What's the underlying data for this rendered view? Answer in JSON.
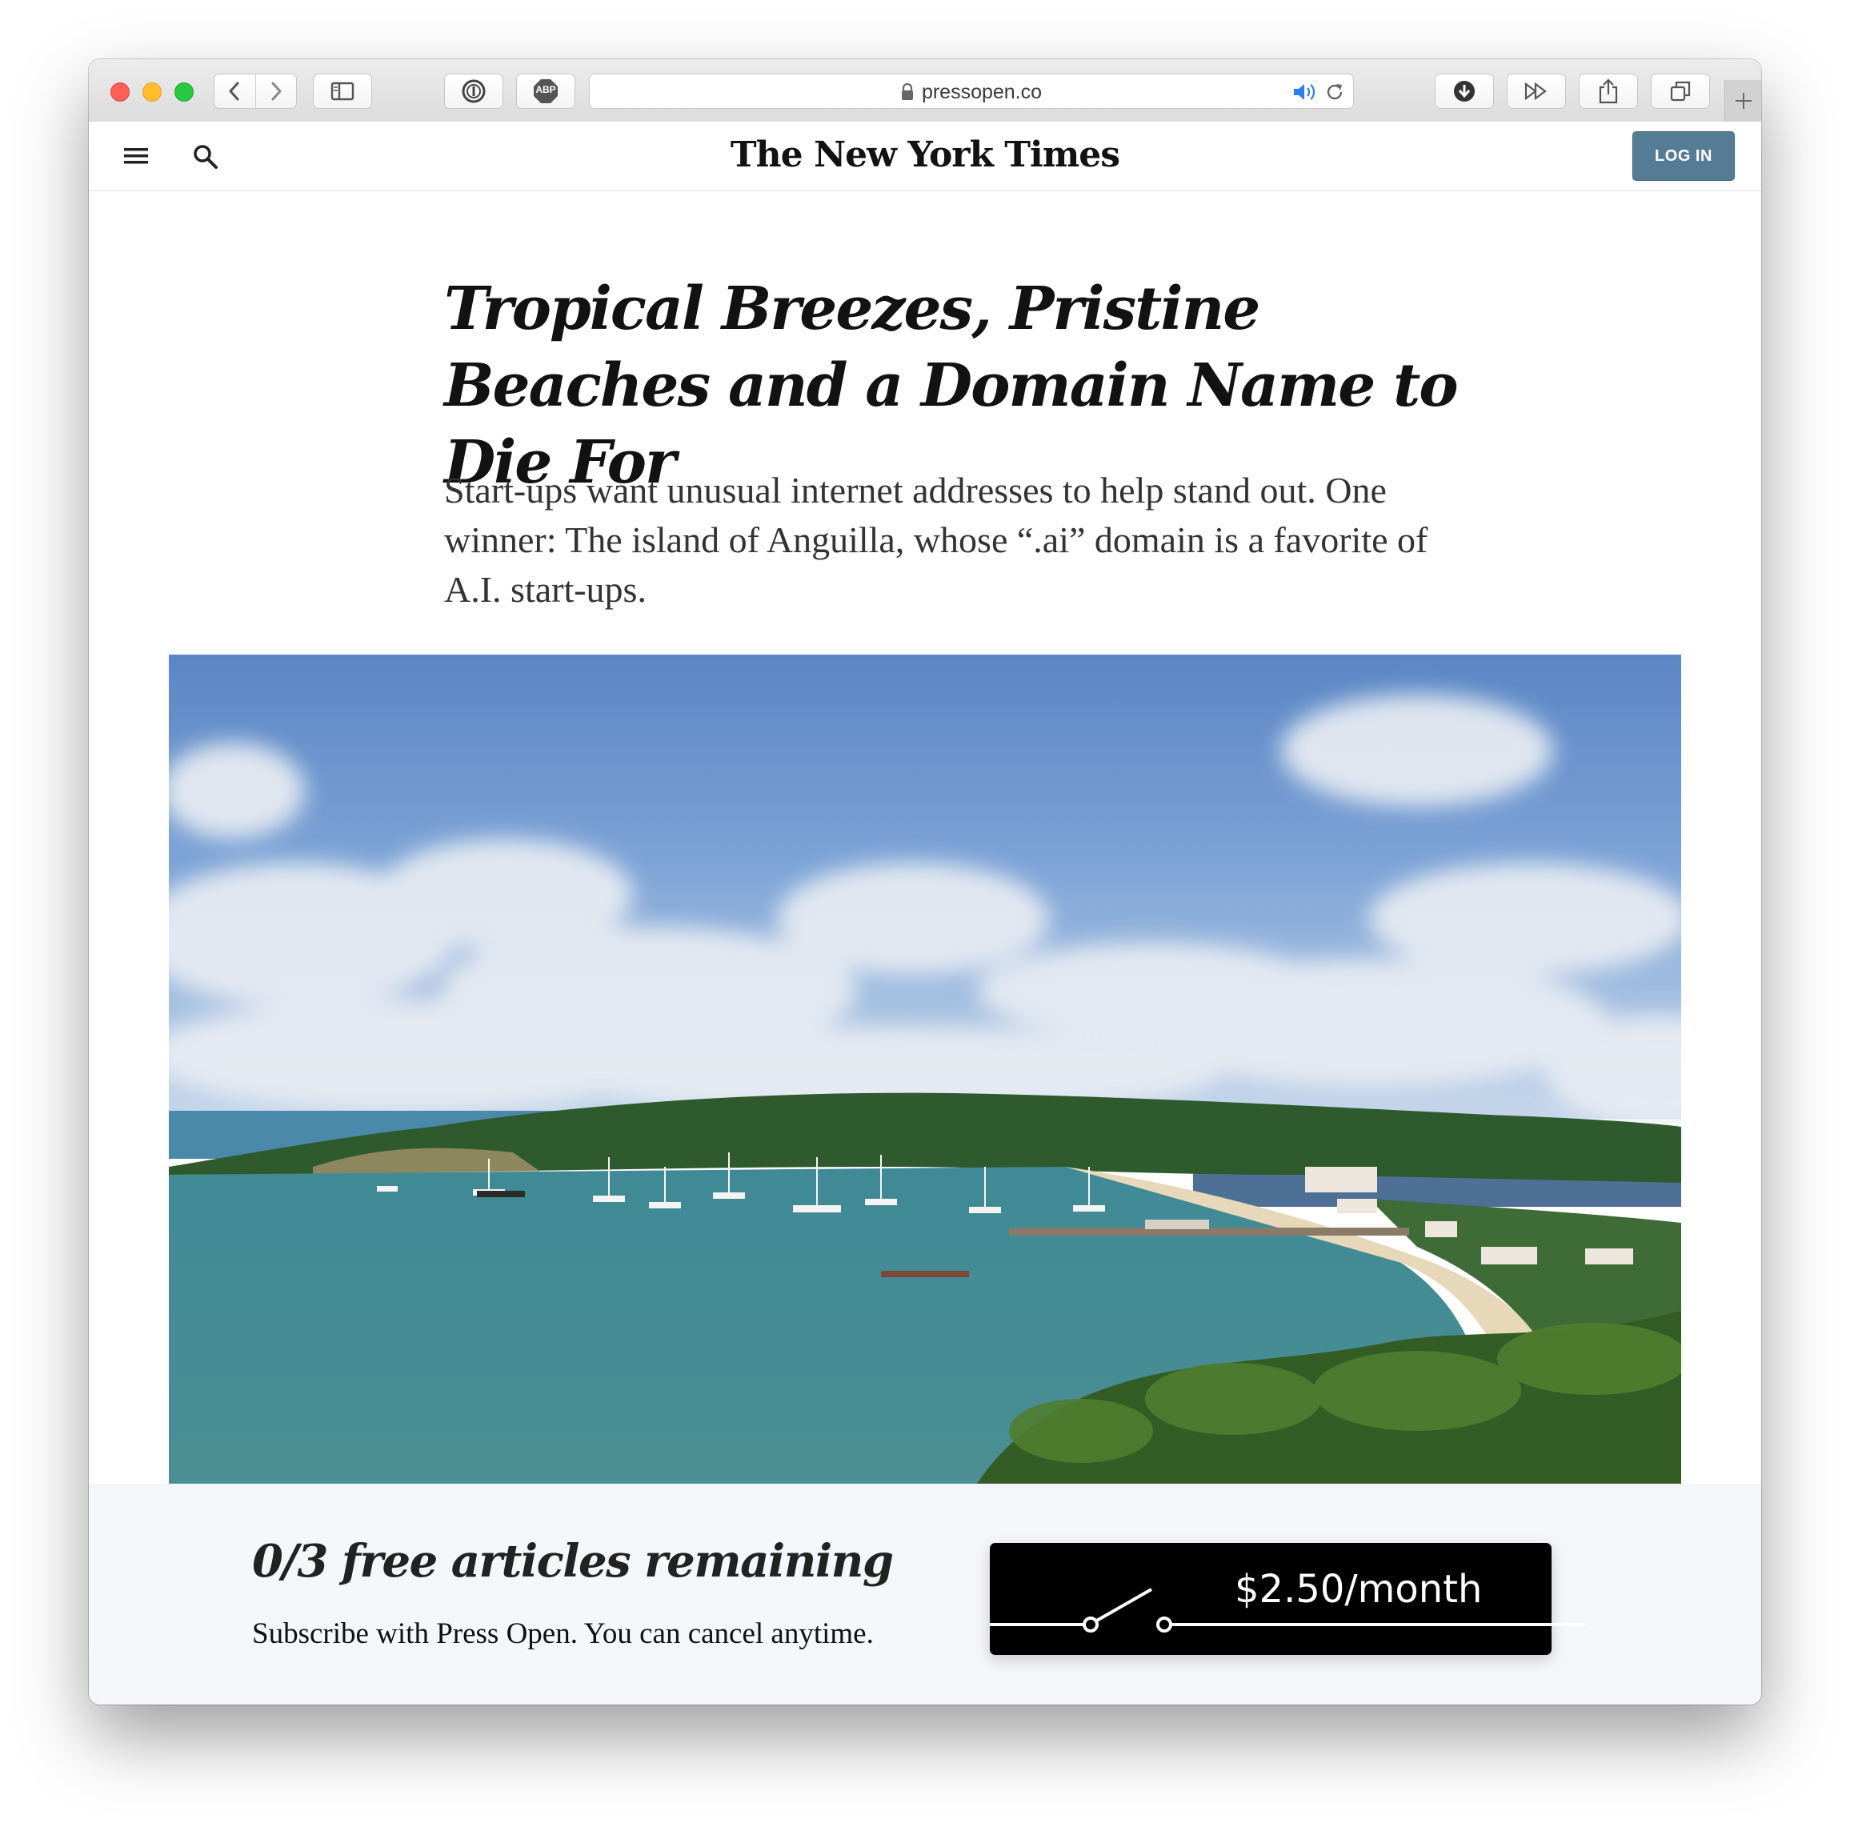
{
  "browser": {
    "url": "pressopen.co",
    "icons": [
      "back-icon",
      "forward-icon",
      "sidebar-icon",
      "onepassword-icon",
      "adblock-icon",
      "lock-icon",
      "speaker-icon",
      "reload-icon",
      "download-icon",
      "forward-skip-icon",
      "share-icon",
      "tabs-icon",
      "plus-icon"
    ],
    "adblock_label": "ABP"
  },
  "header": {
    "masthead": "The New York Times",
    "login_label": "LOG IN"
  },
  "article": {
    "headline": "Tropical Breezes, Pristine Beaches and a Domain Name to Die For",
    "dek": "Start-ups want unusual internet addresses to help stand out. One winner: The island of Anguilla, whose “.ai” domain is a favorite of A.I. start-ups."
  },
  "paywall": {
    "title": "0/3 free articles remaining",
    "subtitle": "Subscribe with Press Open. You can cancel anytime.",
    "price_label": "$2.50/month"
  }
}
